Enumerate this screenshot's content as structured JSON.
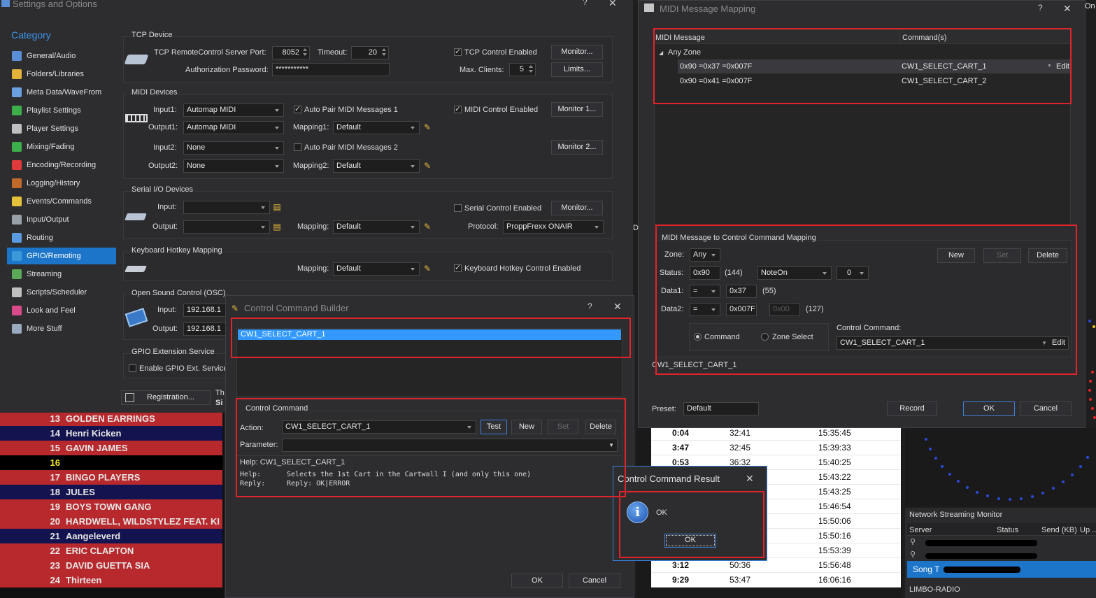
{
  "settings": {
    "title": "Settings and Options",
    "category_header": "Category",
    "nav": [
      {
        "label": "General/Audio",
        "icon": "music-note-icon",
        "color": "#5a8fd8"
      },
      {
        "label": "Folders/Libraries",
        "icon": "folder-icon",
        "color": "#e4b43a"
      },
      {
        "label": "Meta Data/WaveFrom",
        "icon": "metadata-icon",
        "color": "#6aa0e0"
      },
      {
        "label": "Playlist Settings",
        "icon": "play-icon",
        "color": "#3cae4a"
      },
      {
        "label": "Player Settings",
        "icon": "player-icon",
        "color": "#c0c0c0"
      },
      {
        "label": "Mixing/Fading",
        "icon": "mixing-icon",
        "color": "#3cae4a"
      },
      {
        "label": "Encoding/Recording",
        "icon": "record-icon",
        "color": "#e03a3a"
      },
      {
        "label": "Logging/History",
        "icon": "history-icon",
        "color": "#c06a2a"
      },
      {
        "label": "Events/Commands",
        "icon": "lightning-icon",
        "color": "#e6c23a"
      },
      {
        "label": "Input/Output",
        "icon": "io-icon",
        "color": "#9aa0a8"
      },
      {
        "label": "Routing",
        "icon": "routing-icon",
        "color": "#5a9ae0"
      },
      {
        "label": "GPIO/Remoting",
        "icon": "gpio-icon",
        "color": "#3a9ad8"
      },
      {
        "label": "Streaming",
        "icon": "streaming-icon",
        "color": "#5aaa5a"
      },
      {
        "label": "Scripts/Scheduler",
        "icon": "clock-icon",
        "color": "#c0c0c0"
      },
      {
        "label": "Look and Feel",
        "icon": "palette-icon",
        "color": "#d84a8a"
      },
      {
        "label": "More Stuff",
        "icon": "more-stuff-icon",
        "color": "#9aaac0"
      }
    ],
    "selected_index": 11,
    "tcp": {
      "group": "TCP Device",
      "port_label": "TCP RemoteControl Server Port:",
      "port": "8052",
      "timeout_label": "Timeout:",
      "timeout": "20",
      "enabled_label": "TCP Control Enabled",
      "monitor": "Monitor...",
      "auth_label": "Authorization Password:",
      "auth": "***********",
      "maxclients_label": "Max. Clients:",
      "maxclients": "5",
      "limits": "Limits..."
    },
    "midi": {
      "group": "MIDI Devices",
      "input1_label": "Input1:",
      "input1": "Automap MIDI",
      "autopair1": "Auto Pair MIDI Messages 1",
      "control_enabled": "MIDI Control Enabled",
      "monitor1": "Monitor 1...",
      "output1_label": "Output1:",
      "output1": "Automap MIDI",
      "mapping1_label": "Mapping1:",
      "mapping1": "Default",
      "input2_label": "Input2:",
      "input2": "None",
      "autopair2": "Auto Pair MIDI Messages 2",
      "monitor2": "Monitor 2...",
      "output2_label": "Output2:",
      "output2": "None",
      "mapping2_label": "Mapping2:",
      "mapping2": "Default"
    },
    "serial": {
      "group": "Serial I/O Devices",
      "input_label": "Input:",
      "enabled": "Serial Control Enabled",
      "monitor": "Monitor...",
      "output_label": "Output:",
      "mapping_label": "Mapping:",
      "mapping": "Default",
      "protocol_label": "Protocol:",
      "protocol": "ProppFrexx ONAIR"
    },
    "hotkey": {
      "group": "Keyboard Hotkey Mapping",
      "mapping_label": "Mapping:",
      "mapping": "Default",
      "enabled": "Keyboard Hotkey Control Enabled"
    },
    "osc": {
      "group": "Open Sound Control (OSC)",
      "input_label": "Input:",
      "input": "192.168.1",
      "output_label": "Output:",
      "output": "192.168.1"
    },
    "gpio_ext": {
      "group": "GPIO Extension Service",
      "enable": "Enable GPIO Ext. Service"
    },
    "registration": "Registration...",
    "th_text": "Th",
    "si_text": "Si"
  },
  "midi_mapping": {
    "title": "MIDI Message Mapping",
    "col_message": "MIDI Message",
    "col_commands": "Command(s)",
    "group_row": "Any Zone",
    "rows": [
      {
        "message": "0x90 =0x37 =0x007F",
        "command": "CW1_SELECT_CART_1",
        "edit": "Edit"
      },
      {
        "message": "0x90 =0x41 =0x007F",
        "command": "CW1_SELECT_CART_2",
        "edit": ""
      }
    ],
    "side_d": "D",
    "mapping_group": "MIDI Message to Control Command Mapping",
    "zone_label": "Zone:",
    "zone": "Any",
    "new": "New",
    "set": "Set",
    "delete": "Delete",
    "status_label": "Status:",
    "status": "0x90",
    "status_dec": "(144)",
    "status_type": "NoteOn",
    "status_ch": "0",
    "data1_label": "Data1:",
    "data1_op": "=",
    "data1": "0x37",
    "data1_dec": "(55)",
    "data2_label": "Data2:",
    "data2_op": "=",
    "data2": "0x007F",
    "data2_hi": "0x00",
    "data2_dec": "(127)",
    "radio_command": "Command",
    "radio_zone": "Zone Select",
    "control_command_label": "Control Command:",
    "control_command": "CW1_SELECT_CART_1",
    "edit": "Edit",
    "footer_text": "CW1_SELECT_CART_1",
    "preset_label": "Preset:",
    "preset": "Default",
    "record": "Record",
    "ok": "OK",
    "cancel": "Cancel",
    "corner_text": "On"
  },
  "builder": {
    "title": "Control Command Builder",
    "selected_command": "CW1_SELECT_CART_1",
    "group": "Control Command",
    "action_label": "Action:",
    "action": "CW1_SELECT_CART_1",
    "test": "Test",
    "new": "New",
    "set": "Set",
    "delete": "Delete",
    "parameter_label": "Parameter:",
    "help_line": "Help: CW1_SELECT_CART_1",
    "help_label": "Help:",
    "help_text": "Selects the 1st Cart in the Cartwall I (and only this one)",
    "reply_label": "Reply:",
    "reply_text": "Reply: OK|ERROR",
    "ok": "OK",
    "cancel": "Cancel"
  },
  "result": {
    "title": "Control Command Result",
    "message": "OK",
    "ok": "OK"
  },
  "playlist": {
    "rows": [
      {
        "num": "13",
        "artist": "GOLDEN EARRINGS",
        "color": "#b8292d"
      },
      {
        "num": "14",
        "artist": "Henri Kicken",
        "color": "#13134f"
      },
      {
        "num": "15",
        "artist": "GAVIN JAMES",
        "color": "#b8292d"
      },
      {
        "num": "16",
        "artist": "",
        "color": "#000000"
      },
      {
        "num": "17",
        "artist": "BINGO PLAYERS",
        "color": "#b8292d"
      },
      {
        "num": "18",
        "artist": "JULES",
        "color": "#13134f"
      },
      {
        "num": "19",
        "artist": "BOYS TOWN GANG",
        "color": "#b8292d"
      },
      {
        "num": "20",
        "artist": "HARDWELL, WILDSTYLEZ FEAT. KI",
        "color": "#b8292d"
      },
      {
        "num": "21",
        "artist": "Aangeleverd",
        "color": "#13134f"
      },
      {
        "num": "22",
        "artist": "ERIC CLAPTON",
        "color": "#b8292d"
      },
      {
        "num": "23",
        "artist": "DAVID GUETTA   SIA",
        "color": "#b8292d"
      },
      {
        "num": "24",
        "artist": "Thirteen",
        "color": "#b8292d"
      }
    ],
    "times": [
      {
        "len": "0:04",
        "pos": "32:41",
        "clock": "15:35:45"
      },
      {
        "len": "3:47",
        "pos": "32:45",
        "clock": "15:39:33"
      },
      {
        "len": "0:53",
        "pos": "36:32",
        "clock": "15:40:25"
      },
      {
        "len": "",
        "pos": "",
        "clock": "15:43:22"
      },
      {
        "len": "",
        "pos": "",
        "clock": "15:43:25"
      },
      {
        "len": "",
        "pos": "",
        "clock": "15:46:54"
      },
      {
        "len": "",
        "pos": "",
        "clock": "15:50:06"
      },
      {
        "len": "",
        "pos": "",
        "clock": "15:50:16"
      },
      {
        "len": "",
        "pos": "",
        "clock": "15:53:39"
      },
      {
        "len": "3:12",
        "pos": "50:36",
        "clock": "15:56:48"
      },
      {
        "len": "9:29",
        "pos": "53:47",
        "clock": "16:06:16"
      }
    ]
  },
  "streaming": {
    "title": "Network Streaming Monitor",
    "col_server": "Server",
    "col_status": "Status",
    "col_send": "Send (KB)",
    "col_up": "Up ...",
    "song_label": "Song T",
    "footer": "LIMBO-RADIO"
  }
}
